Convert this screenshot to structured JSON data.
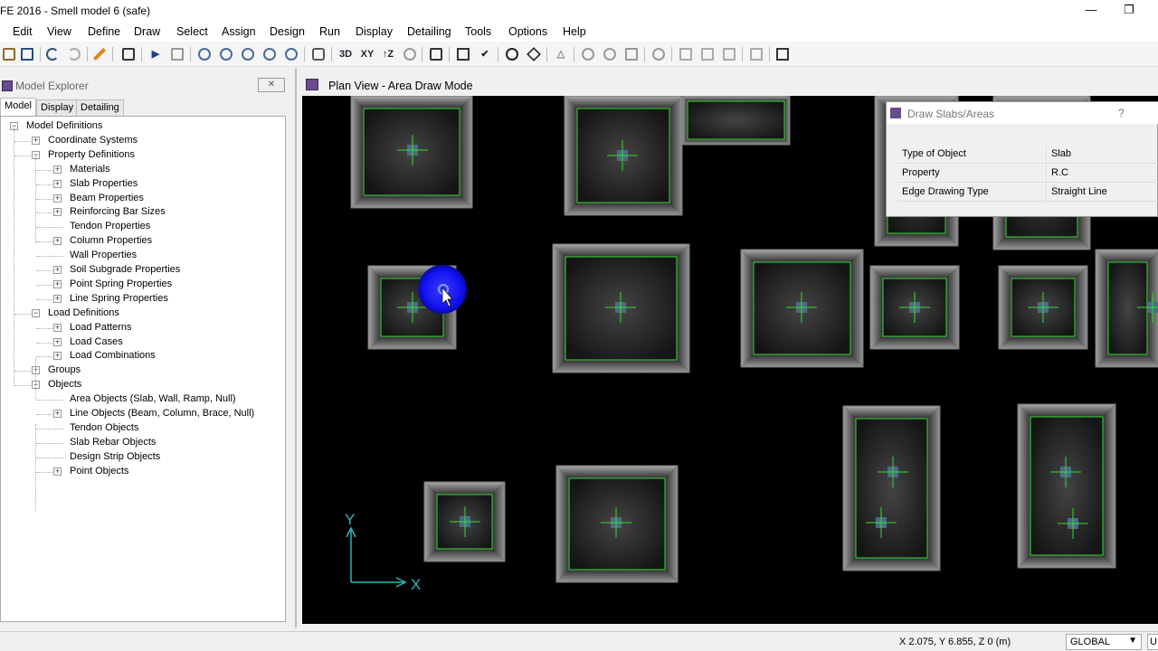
{
  "window": {
    "title": "FE 2016 - Smell model 6 (safe)",
    "minimize_glyph": "—",
    "restore_glyph": "❐"
  },
  "menu": [
    "Edit",
    "View",
    "Define",
    "Draw",
    "Select",
    "Assign",
    "Design",
    "Run",
    "Display",
    "Detailing",
    "Tools",
    "Options",
    "Help"
  ],
  "toolbar": {
    "labels": {
      "view_3d": "3D",
      "view_xy": "XY",
      "view_z": "↑Z"
    },
    "icons": [
      "new-icon",
      "save-icon",
      "undo-icon",
      "redo-icon",
      "pencil-icon",
      "lock-icon",
      "run-icon",
      "run-disabled-icon",
      "zoom-window-icon",
      "zoom-restore-icon",
      "zoom-previous-icon",
      "zoom-in-icon",
      "zoom-out-icon",
      "pan-icon",
      "3d-view-icon",
      "xy-view-icon",
      "z-view-icon",
      "rotate-icon",
      "binoculars-icon",
      "select-grid-icon",
      "check-icon",
      "circle-icon",
      "pointer-icon",
      "triangle-icon",
      "pin-icon",
      "bowl-icon",
      "shelf-icon",
      "tray-icon",
      "bar-icon",
      "stack-icon",
      "frame-icon",
      "grid-icon",
      "table-icon"
    ]
  },
  "explorer": {
    "title": "Model Explorer",
    "close_label": "✕",
    "tabs": [
      "Model",
      "Display",
      "Detailing"
    ],
    "tree": [
      {
        "label": "Model Definitions",
        "level": 0,
        "exp": "−"
      },
      {
        "label": "Coordinate Systems",
        "level": 1,
        "exp": "+"
      },
      {
        "label": "Property Definitions",
        "level": 1,
        "exp": "−"
      },
      {
        "label": "Materials",
        "level": 2,
        "exp": "+"
      },
      {
        "label": "Slab Properties",
        "level": 2,
        "exp": "+"
      },
      {
        "label": "Beam Properties",
        "level": 2,
        "exp": "+"
      },
      {
        "label": "Reinforcing Bar Sizes",
        "level": 2,
        "exp": "+"
      },
      {
        "label": "Tendon Properties",
        "level": 2,
        "exp": ""
      },
      {
        "label": "Column Properties",
        "level": 2,
        "exp": "+"
      },
      {
        "label": "Wall Properties",
        "level": 2,
        "exp": ""
      },
      {
        "label": "Soil Subgrade Properties",
        "level": 2,
        "exp": "+"
      },
      {
        "label": "Point Spring Properties",
        "level": 2,
        "exp": "+"
      },
      {
        "label": "Line Spring Properties",
        "level": 2,
        "exp": "+"
      },
      {
        "label": "Load Definitions",
        "level": 1,
        "exp": "−"
      },
      {
        "label": "Load Patterns",
        "level": 2,
        "exp": "+"
      },
      {
        "label": "Load Cases",
        "level": 2,
        "exp": "+"
      },
      {
        "label": "Load Combinations",
        "level": 2,
        "exp": "+"
      },
      {
        "label": "Groups",
        "level": 1,
        "exp": "+"
      },
      {
        "label": "Objects",
        "level": 1,
        "exp": "−"
      },
      {
        "label": "Area Objects (Slab, Wall, Ramp, Null)",
        "level": 2,
        "exp": ""
      },
      {
        "label": "Line Objects (Beam, Column, Brace, Null)",
        "level": 2,
        "exp": "+"
      },
      {
        "label": "Tendon Objects",
        "level": 2,
        "exp": ""
      },
      {
        "label": "Slab Rebar Objects",
        "level": 2,
        "exp": ""
      },
      {
        "label": "Design Strip Objects",
        "level": 2,
        "exp": ""
      },
      {
        "label": "Point Objects",
        "level": 2,
        "exp": "+"
      }
    ]
  },
  "planview": {
    "title": "Plan View - Area Draw Mode",
    "axis_y": "Y",
    "axis_x": "X"
  },
  "dialog": {
    "title": "Draw Slabs/Areas",
    "help": "?",
    "rows": [
      {
        "key": "Type of Object",
        "value": "Slab"
      },
      {
        "key": "Property",
        "value": "R.C"
      },
      {
        "key": "Edge Drawing Type",
        "value": "Straight Line"
      }
    ]
  },
  "status": {
    "coords": "X 2.075,  Y 6.855,  Z 0  (m)",
    "coord_system": "GLOBAL",
    "units": "U"
  },
  "colors": {
    "canvas_bg": "#000000",
    "footing_edge": "#33dd33",
    "axis": "#2fb5b5",
    "cursor_highlight": "#1010ee"
  }
}
